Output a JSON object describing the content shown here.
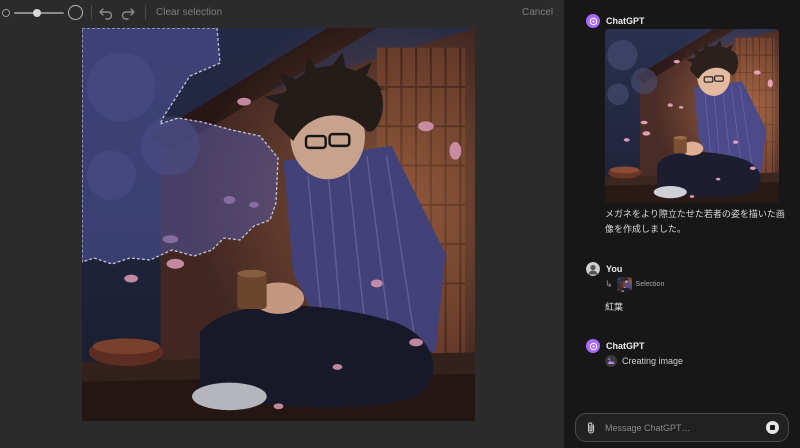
{
  "toolbar": {
    "clear_selection_label": "Clear selection",
    "cancel_label": "Cancel",
    "brush_size": 0.45
  },
  "chat": {
    "messages": [
      {
        "sender": "ChatGPT",
        "text": "メガネをより際立たせた若者の姿を描いた画像を作成しました。"
      },
      {
        "sender": "You",
        "selection_label": "Selection",
        "text": "紅葉"
      },
      {
        "sender": "ChatGPT",
        "status": "Creating image"
      }
    ],
    "input_placeholder": "Message ChatGPT…"
  },
  "colors": {
    "accent": "#ab68ff",
    "selection_tint": "#5f63b8"
  },
  "icons": {
    "undo": "undo-icon",
    "redo": "redo-icon",
    "attach": "paperclip-icon",
    "stop": "stop-icon"
  }
}
